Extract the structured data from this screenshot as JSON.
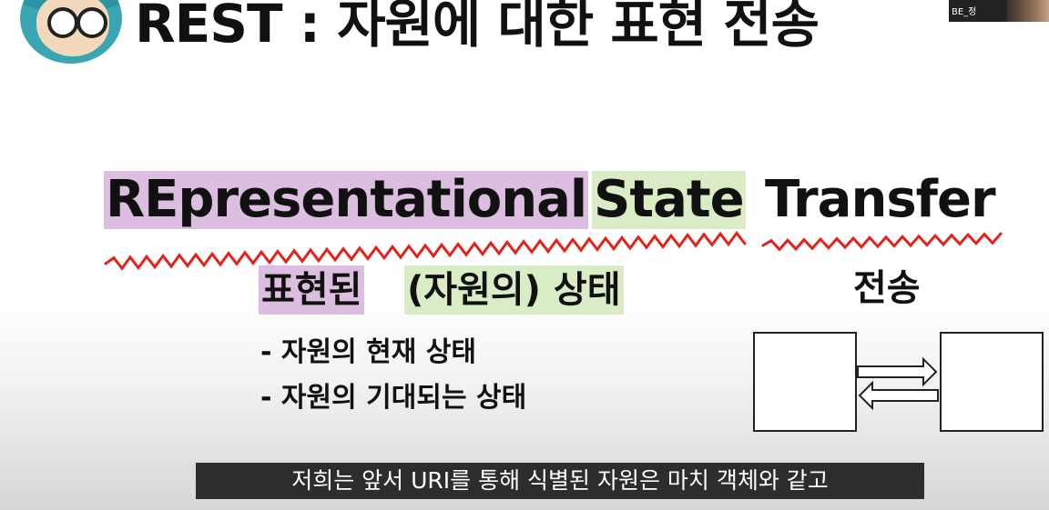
{
  "slide": {
    "title": "REST : 자원에 대한 표현 전송",
    "terms": [
      "REpresentational",
      "State",
      "Transfer"
    ],
    "korean": [
      "표현된",
      "(자원의) 상태",
      "전송"
    ],
    "bullets": [
      "- 자원의 현재 상태",
      "- 자원의 기대되는 상태"
    ]
  },
  "webcam": {
    "label": "BE_정"
  },
  "caption": "저희는 앞서 URI를 통해 식별된 자원은 마치 객체와 같고",
  "colors": {
    "purple_highlight": "#dcbfe0",
    "green_highlight": "#d9ecc6",
    "squiggle": "#e2231a"
  }
}
